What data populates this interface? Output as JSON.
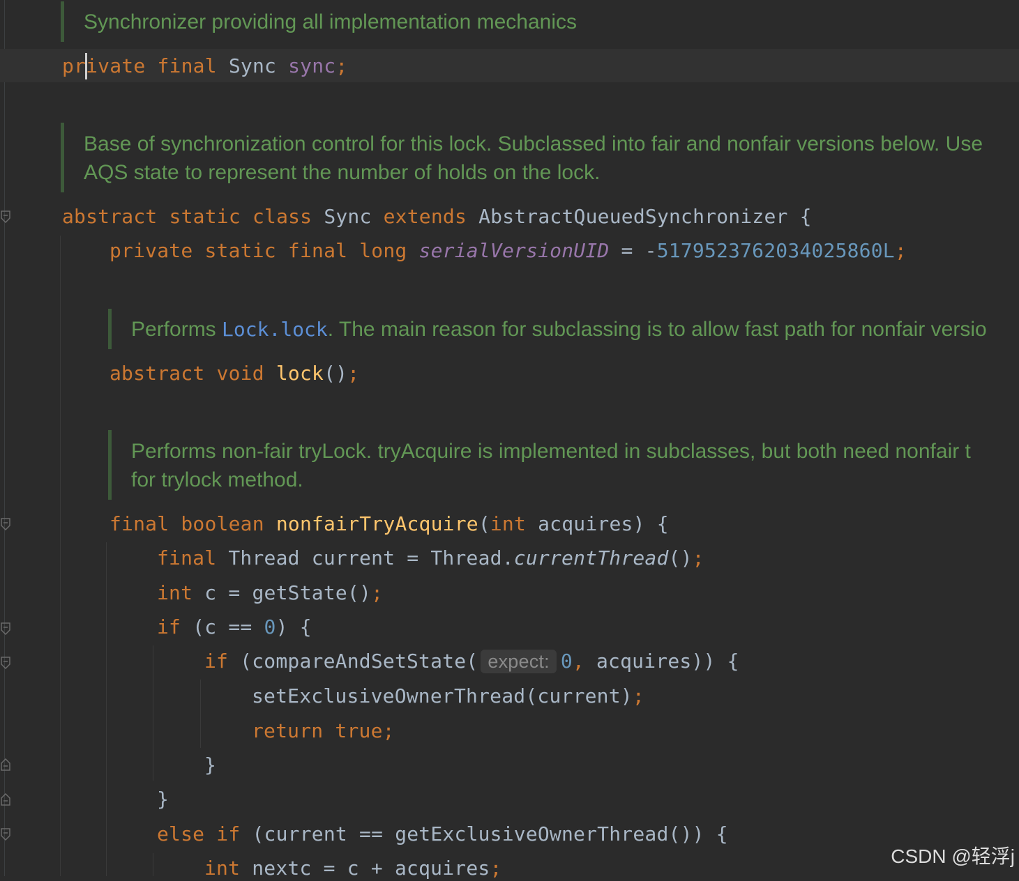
{
  "doc": {
    "sync_field": "Synchronizer providing all implementation mechanics",
    "sync_class_line1": "Base of synchronization control for this lock. Subclassed into fair and nonfair versions below. Use",
    "sync_class_line2": "AQS state to represent the number of holds on the lock.",
    "lock_prefix": "Performs ",
    "lock_link": "Lock.lock",
    "lock_suffix": ". The main reason for subclassing is to allow fast path for nonfair versio",
    "nonfair_line1": "Performs non-fair tryLock. tryAcquire is implemented in subclasses, but both need nonfair t",
    "nonfair_line2": "for trylock method."
  },
  "code": {
    "kw_private": "private",
    "kw_final": "final",
    "kw_abstract": "abstract",
    "kw_static": "static",
    "kw_class": "class",
    "kw_extends": "extends",
    "kw_long": "long",
    "kw_void": "void",
    "kw_boolean": "boolean",
    "kw_int": "int",
    "kw_if": "if",
    "kw_else": "else",
    "kw_return": "return",
    "kw_true": "true",
    "type_sync": "Sync",
    "field_sync": "sync",
    "type_aqs": "AbstractQueuedSynchronizer",
    "field_serial": "serialVersionUID",
    "serial_value": "5179523762034025860L",
    "fn_lock": "lock",
    "fn_nonfair": "nonfairTryAcquire",
    "param_acquires": "acquires",
    "type_thread": "Thread",
    "var_current": "current",
    "fn_current_thread": "currentThread",
    "fn_get_state": "getState",
    "var_c": "c",
    "num_zero": "0",
    "fn_cas": "compareAndSetState",
    "hint_expect": "expect:",
    "fn_set_owner": "setExclusiveOwnerThread",
    "fn_get_owner": "getExclusiveOwnerThread",
    "var_nextc": "nextc"
  },
  "watermark": "CSDN @轻浮j"
}
